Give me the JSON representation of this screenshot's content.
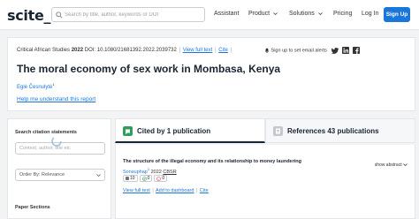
{
  "header": {
    "logo": "scite_",
    "search_placeholder": "Search by title, author, keywords or DOI",
    "nav": {
      "assistant": "Assistant",
      "product": "Product",
      "solutions": "Solutions",
      "pricing": "Pricing",
      "login": "Log In",
      "signup": "Sign Up"
    }
  },
  "article": {
    "journal": "Critical African Studies",
    "year": "2022",
    "doi": "DOI: 10.1080/21681392.2022.2039732",
    "view_full_text": "View full text",
    "cite": "Cite",
    "alerts": "Sign up to set email alerts",
    "title": "The moral economy of sex work in Mombasa, Kenya",
    "author": "Eglė Česnulytė",
    "author_sup": "1",
    "help": "Help me understand this report"
  },
  "sidebar": {
    "search_citations": "Search citation statements",
    "context_placeholder": "Context, author, title etc",
    "order_by": "Order By: Relevance",
    "paper_sections": "Paper Sections"
  },
  "tabs": {
    "cited_by": "Cited by 1 publication",
    "references": "References 43 publications"
  },
  "results": [
    {
      "title": "The structure of the illegal economy and its relationship to money laundering",
      "author": "Sonsuphap",
      "author_sup": "1",
      "year": "2022",
      "journal": "CBSR",
      "badges": {
        "mentioning": "10",
        "supporting": "0",
        "contrasting": "0"
      },
      "view_full_text": "View full text",
      "add_to_dashboard": "Add to dashboard",
      "cite": "Cite",
      "show_abstract": "show abstract"
    }
  ],
  "colors": {
    "accent": "#1b76d9",
    "supporting": "#2e9e5a",
    "contrasting": "#d8413a",
    "mentioning": "#6b7280"
  }
}
